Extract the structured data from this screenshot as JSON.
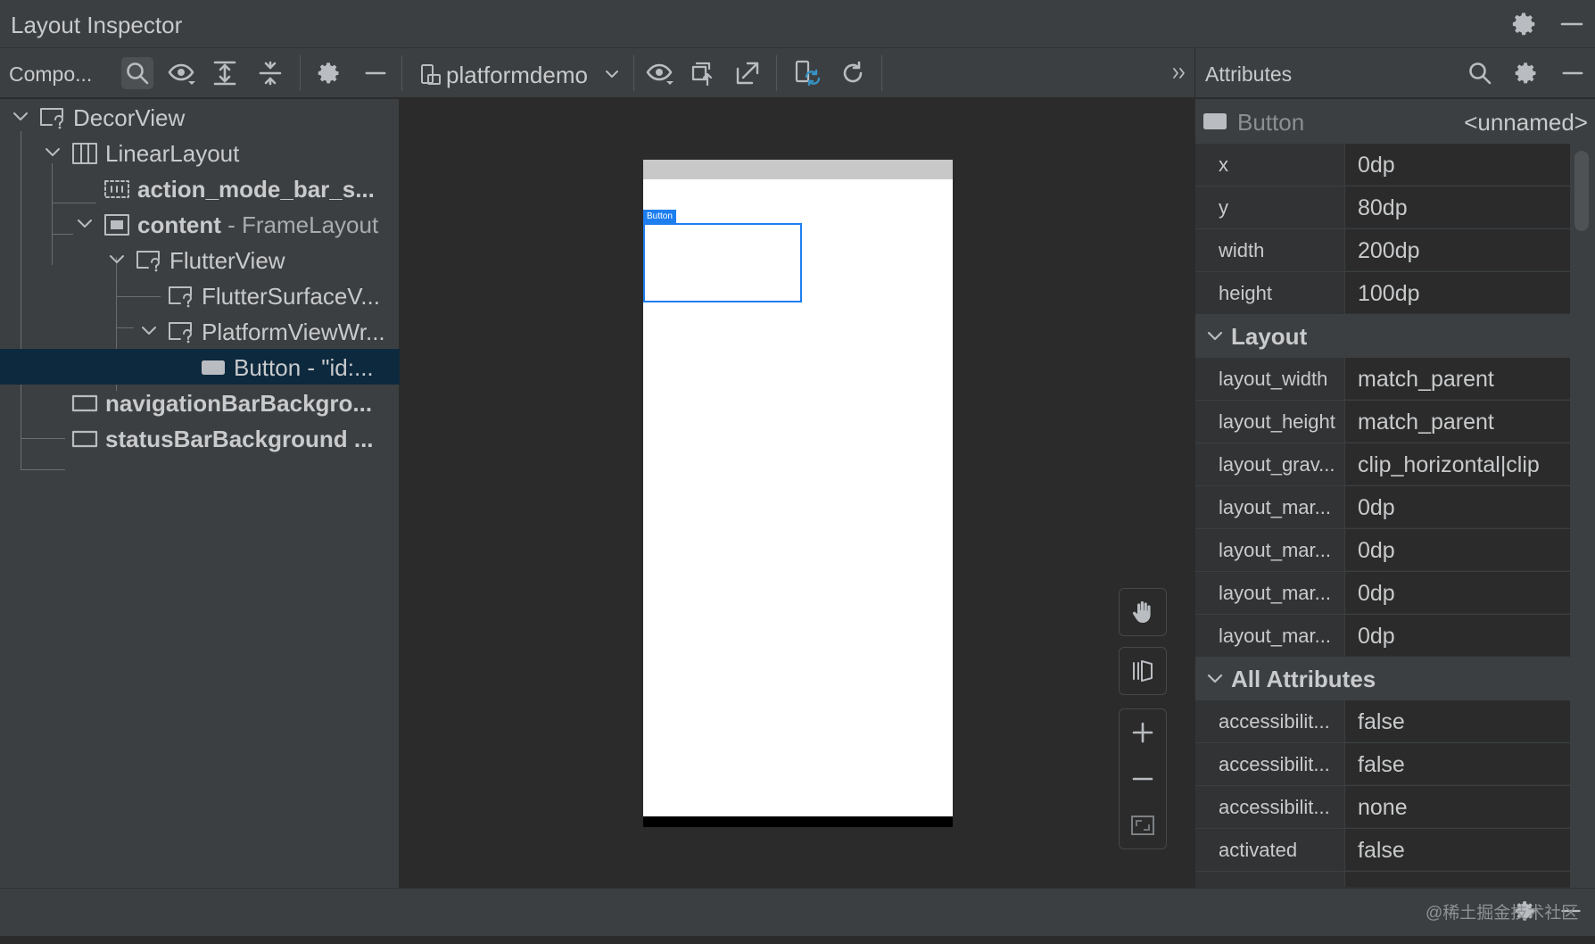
{
  "window": {
    "title": "Layout Inspector"
  },
  "toolbar": {
    "component_tab_label": "Compo...",
    "process_name": "platformdemo",
    "attributes_label": "Attributes"
  },
  "tree": {
    "items": [
      {
        "name": "DecorView",
        "suffix": ""
      },
      {
        "name": "LinearLayout",
        "suffix": ""
      },
      {
        "name": "action_mode_bar_s...",
        "suffix": ""
      },
      {
        "name": "content",
        "suffix": " - FrameLayout"
      },
      {
        "name": "FlutterView",
        "suffix": ""
      },
      {
        "name": "FlutterSurfaceV...",
        "suffix": ""
      },
      {
        "name": "PlatformViewWr...",
        "suffix": ""
      },
      {
        "name": "Button - \"id:...",
        "suffix": ""
      },
      {
        "name": "navigationBarBackgro...",
        "suffix": ""
      },
      {
        "name": "statusBarBackground ...",
        "suffix": ""
      }
    ]
  },
  "device": {
    "button_tag": "Button"
  },
  "attributes": {
    "selected_class": "Button",
    "selected_id": "<unnamed>",
    "basic": [
      {
        "key": "x",
        "value": "0dp"
      },
      {
        "key": "y",
        "value": "80dp"
      },
      {
        "key": "width",
        "value": "200dp"
      },
      {
        "key": "height",
        "value": "100dp"
      }
    ],
    "layout_section": "Layout",
    "layout": [
      {
        "key": "layout_width",
        "value": "match_parent"
      },
      {
        "key": "layout_height",
        "value": "match_parent"
      },
      {
        "key": "layout_grav...",
        "value": "clip_horizontal|clip"
      },
      {
        "key": "layout_mar...",
        "value": "0dp"
      },
      {
        "key": "layout_mar...",
        "value": "0dp"
      },
      {
        "key": "layout_mar...",
        "value": "0dp"
      },
      {
        "key": "layout_mar...",
        "value": "0dp"
      }
    ],
    "all_section": "All Attributes",
    "all": [
      {
        "key": "accessibilit...",
        "value": "false"
      },
      {
        "key": "accessibilit...",
        "value": "false"
      },
      {
        "key": "accessibilit...",
        "value": "none"
      },
      {
        "key": "activated",
        "value": "false"
      }
    ]
  },
  "watermark": "@稀土掘金技术社区",
  "colors": {
    "panel": "#3c3f41",
    "editor": "#2b2b2b",
    "selection": "#0d293e",
    "accent_blue": "#1d7ef0"
  }
}
